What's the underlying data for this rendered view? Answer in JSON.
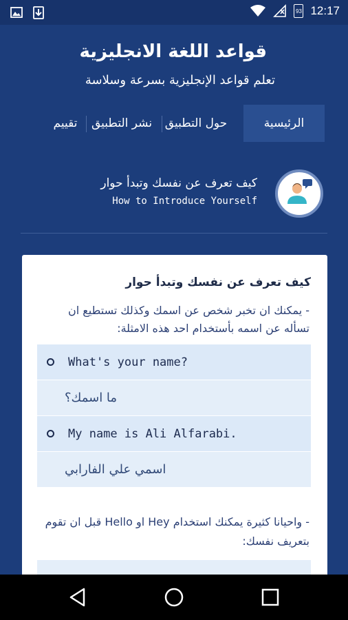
{
  "status_bar": {
    "time": "12:17",
    "badge": "93",
    "icons": [
      "image-icon",
      "download-icon",
      "wifi-icon",
      "signal-icon",
      "battery-icon"
    ]
  },
  "header": {
    "title": "قواعد اللغة الانجليزية",
    "subtitle": "تعلم قواعد الإنجليزية بسرعة وسلاسة"
  },
  "tabs": [
    {
      "label": "الرئيسية",
      "active": true
    },
    {
      "label": "حول التطبيق",
      "active": false
    },
    {
      "label": "نشر التطبيق",
      "active": false
    },
    {
      "label": "تقييم",
      "active": false
    }
  ],
  "lesson": {
    "title_ar": "كيف تعرف عن نفسك وتبدأ حوار",
    "title_en": "How to Introduce Yourself"
  },
  "card": {
    "title": "كيف تعرف عن نفسك وتبدأ حوار",
    "intro": "- يمكنك ان تخبر شخص عن اسمك وكذلك تستطيع ان تسأله عن اسمه بأستخدام احد هذه الامثلة:",
    "examples": [
      {
        "en": "What's your name?",
        "ar": "ما اسمك؟"
      },
      {
        "en": "My name is Ali Alfarabi.",
        "ar": "اسمي علي الفارابي"
      }
    ],
    "note": "- واحيانا كثيرة يمكنك استخدام Hey او Hello قبل ان تقوم بتعريف نفسك:"
  },
  "colors": {
    "primary": "#1c3d7b",
    "status_bar": "#17336b",
    "tab_active": "#2a4f91",
    "card": "#ffffff",
    "row_light": "#dce9f8"
  }
}
